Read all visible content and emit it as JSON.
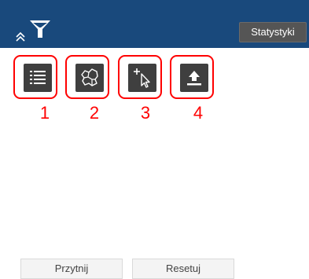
{
  "header": {
    "stats_label": "Statystyki",
    "collapse_icon": "double-chevron-up-icon",
    "filter_icon": "filter-funnel-icon",
    "bar_color": "#19497c"
  },
  "tools": [
    {
      "icon": "list-icon",
      "annotation": "1"
    },
    {
      "icon": "map-regions-icon",
      "annotation": "2"
    },
    {
      "icon": "add-select-cursor-icon",
      "annotation": "3"
    },
    {
      "icon": "upload-icon",
      "annotation": "4"
    }
  ],
  "annotation_color": "#ff0000",
  "footer": {
    "trim_label": "Przytnij",
    "reset_label": "Resetuj"
  }
}
